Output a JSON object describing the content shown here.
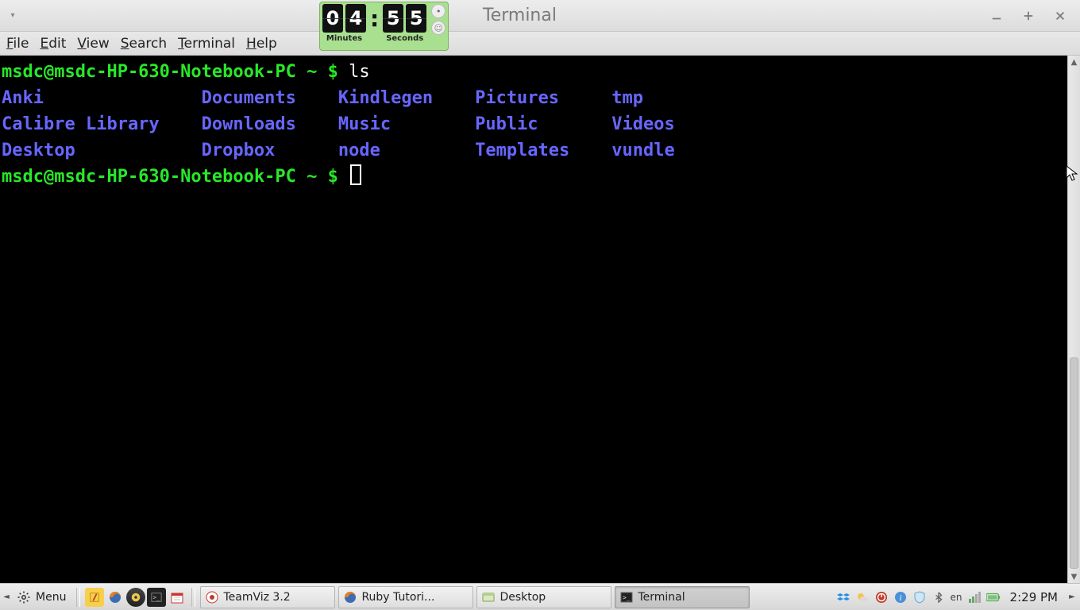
{
  "window": {
    "title": "Terminal"
  },
  "timer": {
    "minutes": "04",
    "seconds": "55",
    "label_minutes": "Minutes",
    "label_seconds": "Seconds"
  },
  "menus": {
    "file": {
      "label": "File",
      "u": "F",
      "rest": "ile"
    },
    "edit": {
      "label": "Edit",
      "u": "E",
      "rest": "dit"
    },
    "view": {
      "label": "View",
      "u": "V",
      "rest": "iew"
    },
    "search": {
      "label": "Search",
      "u": "S",
      "rest": "earch"
    },
    "terminal": {
      "label": "Terminal",
      "u": "T",
      "rest": "erminal"
    },
    "help": {
      "label": "Help",
      "u": "H",
      "rest": "elp"
    }
  },
  "terminal": {
    "prompt": "msdc@msdc-HP-630-Notebook-PC ~ $",
    "command": "ls",
    "listing": {
      "col1": [
        "Anki",
        "Calibre Library",
        "Desktop"
      ],
      "col2": [
        "Documents",
        "Downloads",
        "Dropbox"
      ],
      "col3": [
        "Kindlegen",
        "Music",
        "node"
      ],
      "col4": [
        "Pictures",
        "Public",
        "Templates"
      ],
      "col5": [
        "tmp",
        "Videos",
        "vundle"
      ]
    }
  },
  "taskbar": {
    "menu_label": "Menu",
    "tasks": [
      {
        "label": "TeamViz 3.2"
      },
      {
        "label": "Ruby Tutori..."
      },
      {
        "label": "Desktop"
      },
      {
        "label": "Terminal"
      }
    ],
    "lang": "en",
    "clock": "2:29 PM"
  }
}
